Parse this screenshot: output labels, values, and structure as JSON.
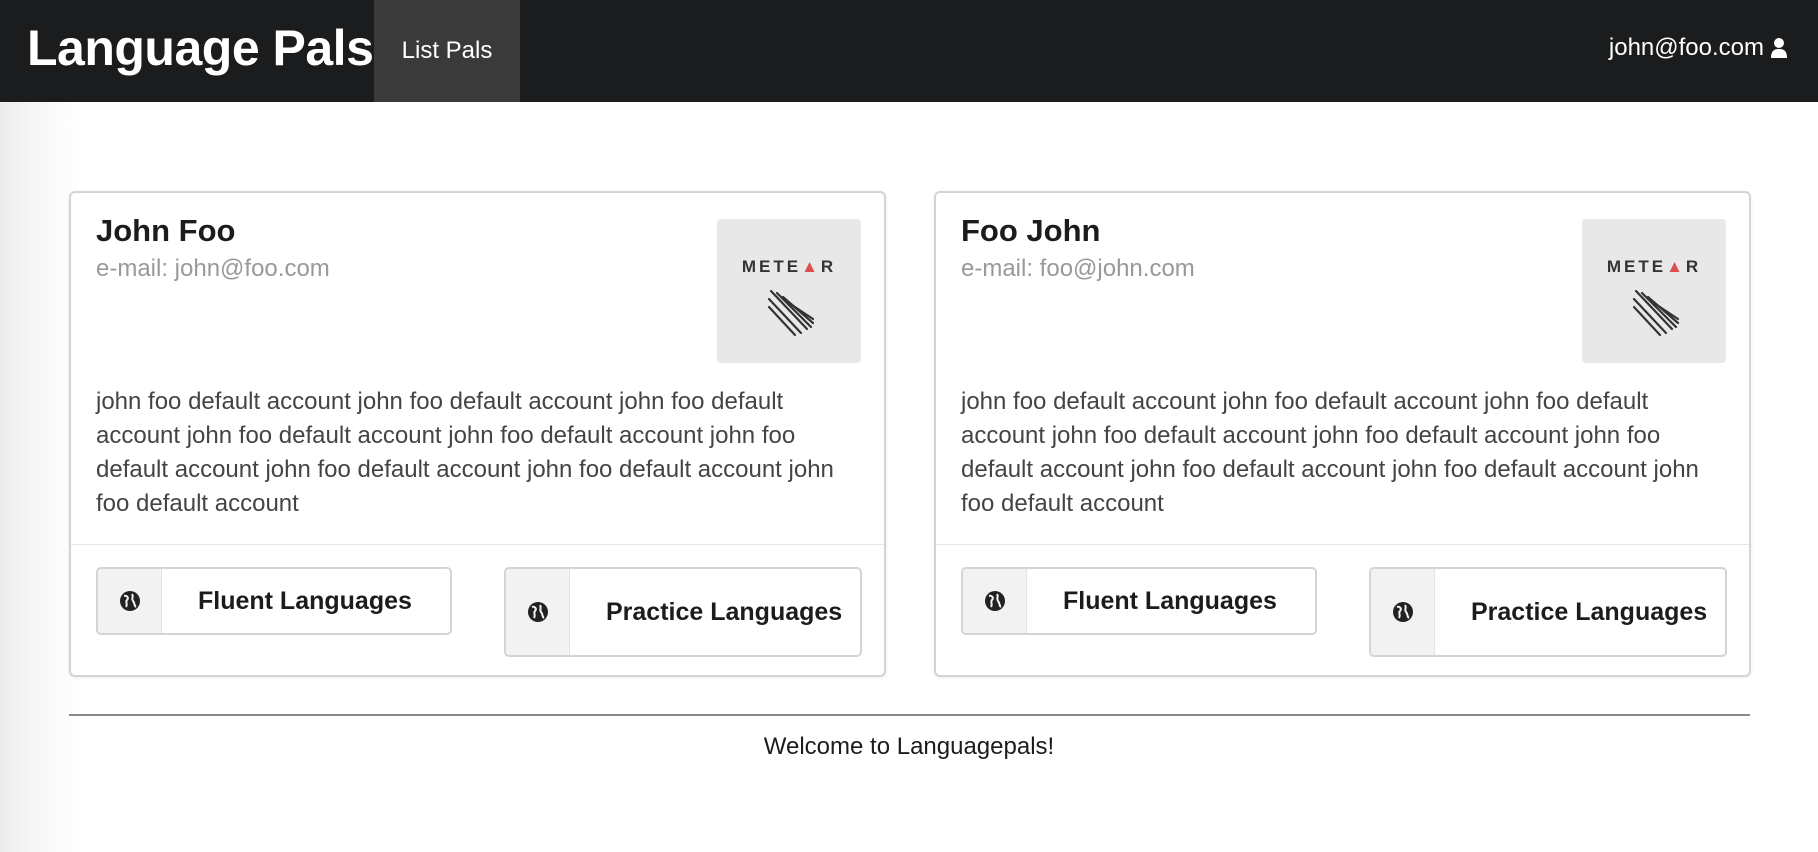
{
  "navbar": {
    "brand": "Language Pals",
    "nav_item": "List Pals",
    "user_email": "john@foo.com",
    "user_icon": "user-icon"
  },
  "cards": [
    {
      "name": "John Foo",
      "meta": "e-mail: john@foo.com",
      "image_alt": "METEOR",
      "description": "john foo default account john foo default account john foo default account john foo default account john foo default account john foo default account john foo default account john foo default account john foo default account",
      "fluent_label": "Fluent Languages",
      "practice_label": "Practice Languages",
      "button_icon": "globe-icon"
    },
    {
      "name": "Foo John",
      "meta": "e-mail: foo@john.com",
      "image_alt": "METEOR",
      "description": "john foo default account john foo default account john foo default account john foo default account john foo default account john foo default account john foo default account john foo default account john foo default account",
      "fluent_label": "Fluent Languages",
      "practice_label": "Practice Languages",
      "button_icon": "globe-icon"
    }
  ],
  "footer": {
    "text": "Welcome to Languagepals!"
  },
  "colors": {
    "navbar_bg": "#1b1c1d",
    "nav_active_bg": "#3a3a3b",
    "card_border": "#d4d4d5",
    "meta_text": "#999999",
    "meteor_red": "#de4f4f"
  }
}
